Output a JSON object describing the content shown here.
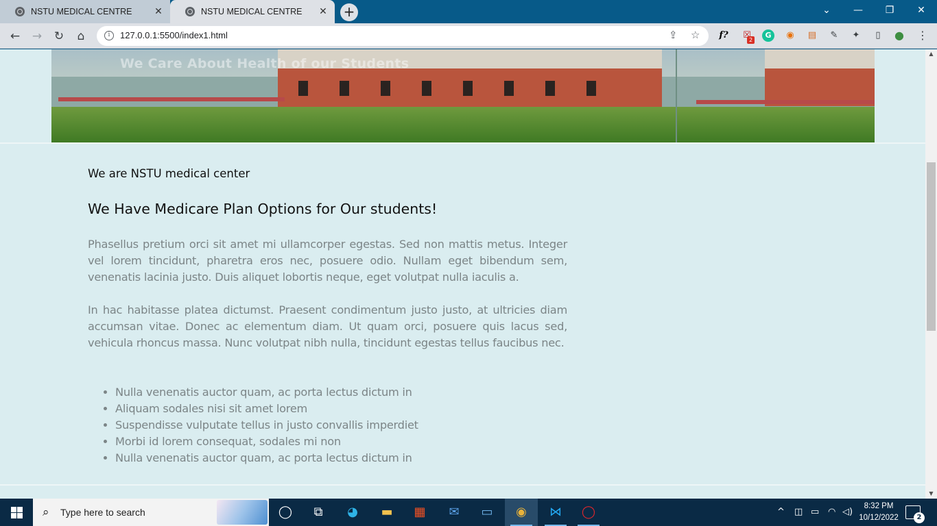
{
  "browser": {
    "tabs": [
      {
        "title": "NSTU MEDICAL CENTRE",
        "close": "✕"
      },
      {
        "title": "NSTU MEDICAL CENTRE",
        "close": "✕"
      }
    ],
    "new_tab": "+",
    "window_controls": {
      "dropdown": "⌄",
      "minimize": "—",
      "restore": "❐",
      "close": "✕"
    },
    "nav": {
      "back": "←",
      "forward": "→",
      "reload": "↻",
      "home": "⌂"
    },
    "omnibox": {
      "info": "i",
      "url": "127.0.0.1:5500/index1.html",
      "share": "⇪",
      "star": "☆"
    },
    "extensions": [
      "f?",
      "☒",
      "G",
      "◉",
      "▤",
      "✎",
      "✦",
      "▯",
      "●"
    ],
    "extension_badge": "2"
  },
  "page": {
    "banner_caption": "We Care About Health of our Students",
    "intro": "We are NSTU medical center",
    "headline": "We Have Medicare Plan Options for Our students!",
    "paragraphs": [
      "Phasellus pretium orci sit amet mi ullamcorper egestas. Sed non mattis metus. Integer vel lorem tincidunt, pharetra eros nec, posuere odio. Nullam eget bibendum sem, venenatis lacinia justo. Duis aliquet lobortis neque, eget volutpat nulla iaculis a.",
      "In hac habitasse platea dictumst. Praesent condimentum justo justo, at ultricies diam accumsan vitae. Donec ac elementum diam. Ut quam orci, posuere quis lacus sed, vehicula rhoncus massa. Nunc volutpat nibh nulla, tincidunt egestas tellus faucibus nec."
    ],
    "bullets": [
      "Nulla venenatis auctor quam, ac porta lectus dictum in",
      "Aliquam sodales nisi sit amet lorem",
      "Suspendisse vulputate tellus in justo convallis imperdiet",
      "Morbi id lorem consequat, sodales mi non",
      "Nulla venenatis auctor quam, ac porta lectus dictum in"
    ]
  },
  "scrollbar": {
    "up": "▲",
    "down": "▼"
  },
  "taskbar": {
    "search_icon": "⌕",
    "search_placeholder": "Type here to search",
    "icons": [
      "cortana-icon",
      "task-view-icon",
      "edge-icon",
      "file-explorer-icon",
      "store-icon",
      "mail-icon",
      "remote-desktop-icon",
      "chrome-icon",
      "vscode-icon",
      "opera-icon"
    ],
    "tray": {
      "chevron": "^",
      "meet": "◫",
      "battery": "▭",
      "wifi": "◠",
      "volume": "◁)"
    },
    "time": "8:32 PM",
    "date": "10/12/2022",
    "notifications": "2"
  },
  "colors": {
    "tab_strip": "#075a89",
    "toolbar": "#dee1e6",
    "page_bg": "#daedf0",
    "body_text": "#7c8587",
    "taskbar": "#0a2a45"
  }
}
